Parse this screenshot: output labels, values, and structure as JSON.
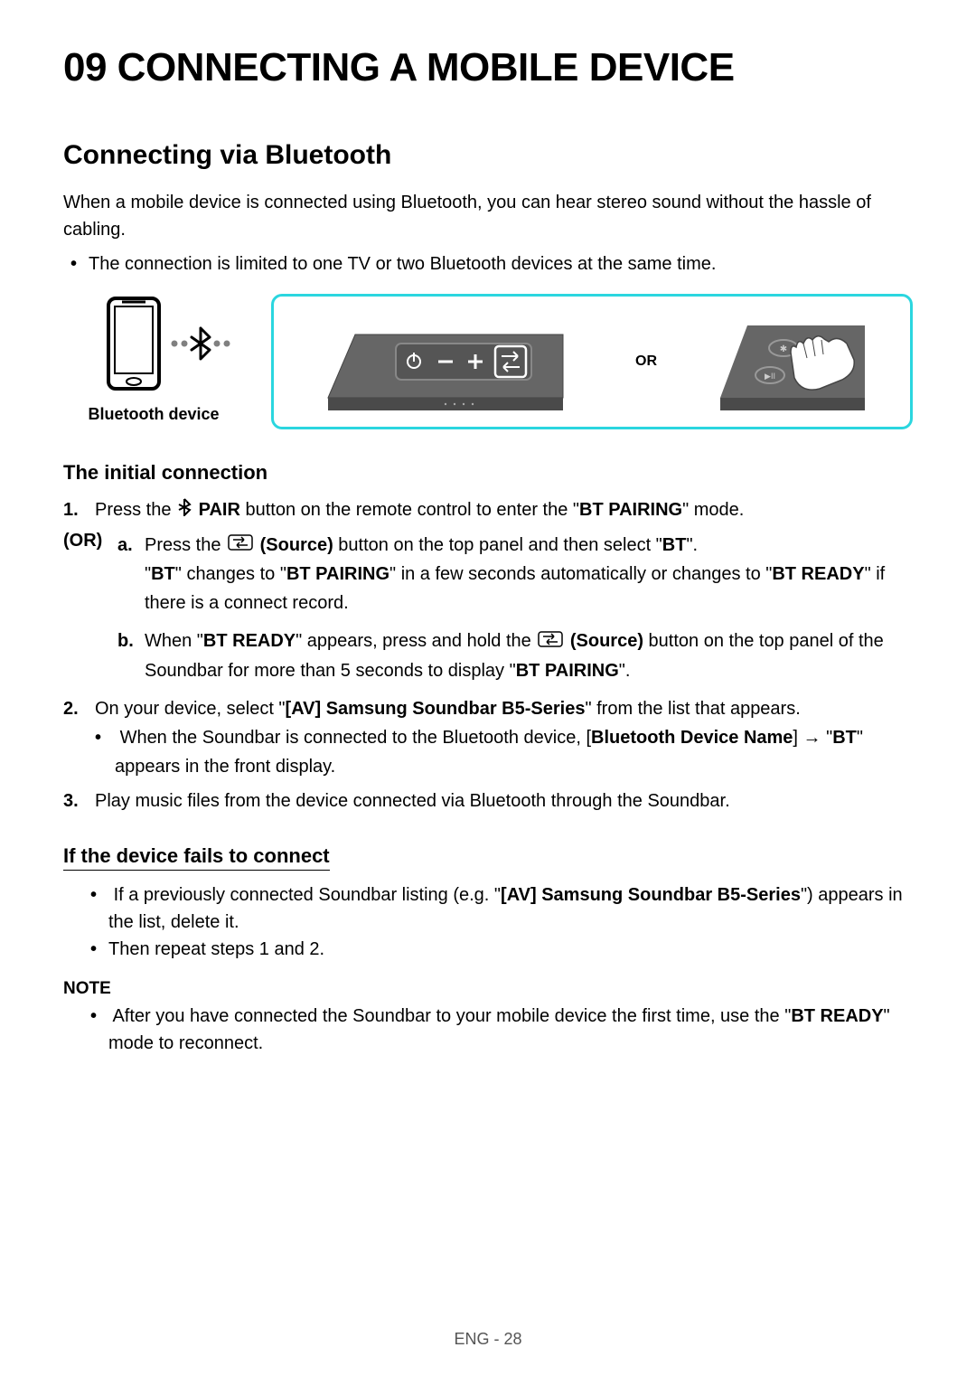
{
  "chapter_title": "09   CONNECTING A MOBILE DEVICE",
  "section_title": "Connecting via Bluetooth",
  "intro_text": "When a mobile device is connected using Bluetooth, you can hear stereo sound without the hassle of cabling.",
  "intro_bullet": "The connection is limited to one TV or two Bluetooth devices at the same time.",
  "diagram": {
    "bt_device_label": "Bluetooth device",
    "or_label": "OR"
  },
  "initial": {
    "heading": "The initial connection",
    "step1": {
      "pre": "Press the ",
      "pair_label": " PAIR",
      "post": " button on the remote control to enter the \"",
      "btpairing": "BT PAIRING",
      "end": "\" mode."
    },
    "or": "(OR)",
    "step_a": {
      "pre": "Press the ",
      "source": " (Source)",
      "mid": " button on the top panel and then select \"",
      "bt": "BT",
      "end": "\".",
      "line2_a": "\"",
      "line2_bt": "BT",
      "line2_b": "\" changes to \"",
      "line2_pair": "BT PAIRING",
      "line2_c": "\" in a few seconds automatically or changes to \"",
      "line2_ready": "BT READY",
      "line2_d": "\" if there is a connect record."
    },
    "step_b": {
      "pre": "When \"",
      "ready": "BT READY",
      "mid1": "\" appears, press and hold the ",
      "source": " (Source)",
      "mid2": " button on the top panel of the Soundbar for more than 5 seconds to display \"",
      "pair": "BT PAIRING",
      "end": "\"."
    },
    "step2": {
      "pre": "On your device, select \"",
      "dev": "[AV] Samsung Soundbar B5-Series",
      "post": "\" from the list that appears.",
      "bullet_pre": "When the Soundbar is connected to the Bluetooth device, [",
      "bullet_name": "Bluetooth Device Name",
      "bullet_arrow": "] → \"",
      "bullet_bt": "BT",
      "bullet_post": "\" appears in the front display."
    },
    "step3": "Play music files from the device connected via Bluetooth through the Soundbar."
  },
  "fails": {
    "heading": "If the device fails to connect",
    "b1_pre": "If a previously connected Soundbar listing (e.g. \"",
    "b1_dev": "[AV] Samsung Soundbar B5-Series",
    "b1_post": "\") appears in the list, delete it.",
    "b2": "Then repeat steps 1 and 2."
  },
  "note": {
    "label": "NOTE",
    "text_pre": "After you have connected the Soundbar to your mobile device the first time, use the \"",
    "ready": "BT READY",
    "text_post": "\" mode to reconnect."
  },
  "footer": "ENG - 28"
}
